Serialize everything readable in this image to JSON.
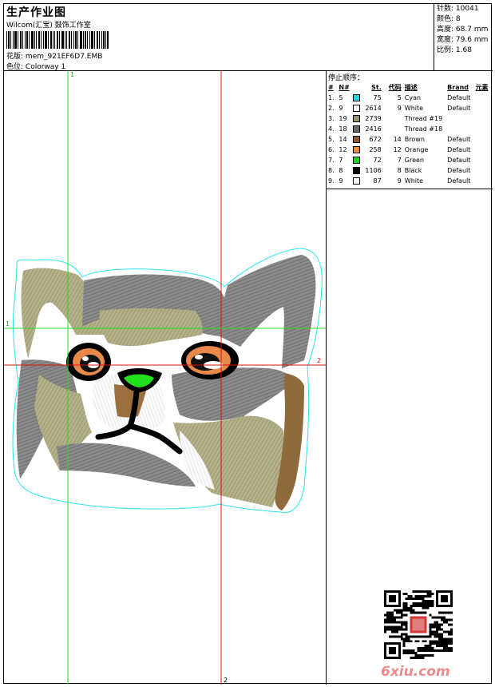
{
  "header": {
    "title": "生产作业图",
    "company": "Wilcom(汇宝) 鼓饰工作室",
    "design_label": "花版",
    "design_file": "mem_921EF6D7.EMB",
    "colorway_label": "色位",
    "colorway": "Colorway 1"
  },
  "stats": [
    {
      "label": "针数",
      "value": "10041"
    },
    {
      "label": "颜色",
      "value": "8"
    },
    {
      "label": "高度",
      "value": "68.7 mm"
    },
    {
      "label": "宽度",
      "value": "79.6 mm"
    },
    {
      "label": "比例",
      "value": "1.68"
    }
  ],
  "stop_sequence": {
    "title": "停止顺序：",
    "columns": [
      "#",
      "N#",
      "St.",
      "代码",
      "描述",
      "Brand",
      "元素"
    ],
    "rows": [
      {
        "idx": "1.",
        "n": "5",
        "color": "#24d8e0",
        "st": "75",
        "code": "5",
        "desc": "Cyan",
        "brand": "Default"
      },
      {
        "idx": "2.",
        "n": "9",
        "color": "#ffffff",
        "st": "2614",
        "code": "9",
        "desc": "White",
        "brand": "Default"
      },
      {
        "idx": "3.",
        "n": "19",
        "color": "#96966c",
        "st": "2739",
        "code": "",
        "desc": "Thread #19",
        "brand": ""
      },
      {
        "idx": "4.",
        "n": "18",
        "color": "#6a6a6a",
        "st": "2416",
        "code": "",
        "desc": "Thread #18",
        "brand": ""
      },
      {
        "idx": "5.",
        "n": "14",
        "color": "#8c5a2c",
        "st": "672",
        "code": "14",
        "desc": "Brown",
        "brand": "Default"
      },
      {
        "idx": "6.",
        "n": "12",
        "color": "#f08a3c",
        "st": "258",
        "code": "12",
        "desc": "Orange",
        "brand": "Default"
      },
      {
        "idx": "7.",
        "n": "7",
        "color": "#16d81a",
        "st": "72",
        "code": "7",
        "desc": "Green",
        "brand": "Default"
      },
      {
        "idx": "8.",
        "n": "8",
        "color": "#000000",
        "st": "1106",
        "code": "8",
        "desc": "Black",
        "brand": "Default"
      },
      {
        "idx": "9.",
        "n": "9",
        "color": "#ffffff",
        "st": "87",
        "code": "9",
        "desc": "White",
        "brand": "Default"
      }
    ]
  },
  "guides": {
    "v1": "1",
    "v2": "2",
    "h1": "1",
    "h2": "2"
  },
  "watermark": "6xiu.com"
}
